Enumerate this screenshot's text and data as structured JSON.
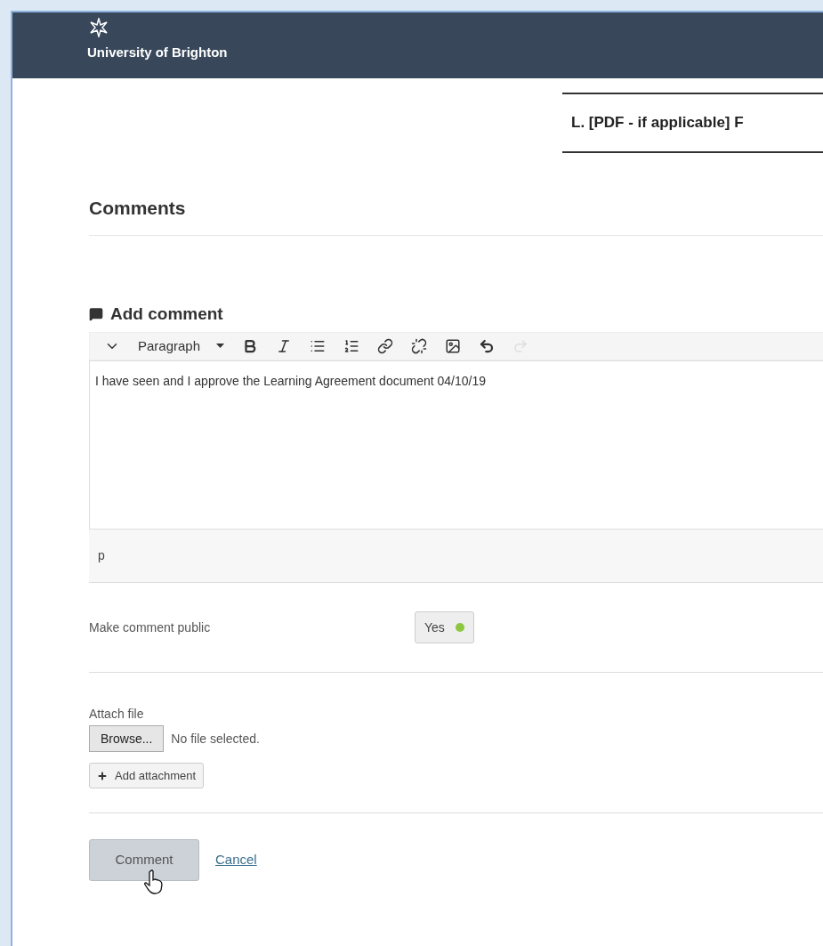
{
  "header": {
    "brand": "University of Brighton"
  },
  "section_tab": {
    "label": "L. [PDF - if applicable] F"
  },
  "comments": {
    "title": "Comments"
  },
  "add_comment": {
    "title": "Add comment",
    "toolbar": {
      "format": "Paragraph",
      "undo_disabled": false,
      "redo_disabled": true
    },
    "value": "I have seen and I approve the Learning Agreement document 04/10/19",
    "path": "p",
    "public": {
      "label": "Make comment public",
      "value": "Yes",
      "on": true
    },
    "attach": {
      "label": "Attach file",
      "browse": "Browse...",
      "status": "No file selected.",
      "add": "Add attachment"
    },
    "submit": "Comment",
    "cancel": "Cancel"
  }
}
